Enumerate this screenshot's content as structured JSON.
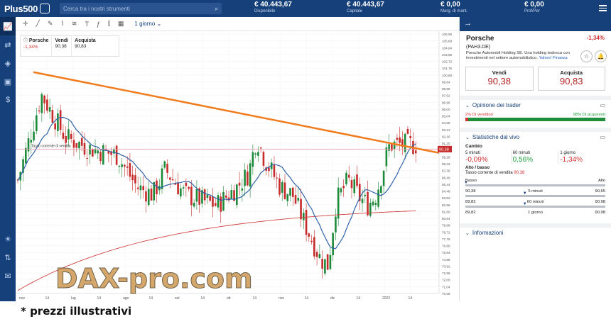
{
  "topbar": {
    "logo": "Plus500",
    "search_placeholder": "Cerca tra i nostri strumenti",
    "stats": [
      {
        "value": "€ 40.443,67",
        "label": "Disponibile"
      },
      {
        "value": "€ 40.443,67",
        "label": "Capitale"
      },
      {
        "value": "€ 0,00",
        "label": "Marg. di mant."
      },
      {
        "value": "€ 0,00",
        "label": "Prof/Per"
      }
    ]
  },
  "toolbar": {
    "timeframe": "1 giorno"
  },
  "infobox": {
    "name": "Porsche",
    "change": "-1,34%",
    "sell_label": "Vendi",
    "sell": "90,38",
    "buy_label": "Acquista",
    "buy": "90,83"
  },
  "chart_data": {
    "type": "candlestick",
    "x_ticks": [
      "nov",
      "14",
      "lug",
      "14",
      "ago",
      "14",
      "set",
      "14",
      "ott",
      "14",
      "nov",
      "14",
      "dic",
      "14",
      "2022",
      "14"
    ],
    "y_ticks": [
      "106,56",
      "105,60",
      "104,64",
      "103,68",
      "102,72",
      "101,76",
      "100,80",
      "99,84",
      "98,88",
      "97,92",
      "96,96",
      "96,00",
      "95,04",
      "94,08",
      "93,12",
      "92,16",
      "91,20",
      "90,24",
      "89,28",
      "88,32",
      "87,36",
      "86,40",
      "85,44",
      "84,48",
      "83,52",
      "82,56",
      "81,60",
      "80,64",
      "79,68",
      "78,72",
      "77,76",
      "76,80",
      "75,84",
      "74,88",
      "73,92",
      "72,96",
      "72,00",
      "71,04",
      "70,08"
    ],
    "ylim": [
      70.08,
      106.56
    ],
    "price_line_label": "90,38",
    "price_line_text": "Tasso corrente di vendita",
    "price": 90.38,
    "trendline": [
      [
        0.04,
        101.2
      ],
      [
        0.975,
        89.6
      ]
    ],
    "colors": {
      "up": "#1d8a3a",
      "down": "#c62a2a",
      "ma_fast": "#2f62a8",
      "ma_slow": "#d24242",
      "trend": "#f07c1e"
    }
  },
  "watermark": "DAX-pro.com",
  "panel": {
    "name": "Porsche",
    "change": "-1,34%",
    "ticker": "(PAH3.DE)",
    "description": "Porsche Automobil Holding SE. Una holding tedesca con investimenti nel settore automobilistico.",
    "source": "Yahoo! Finanza",
    "sell_label": "Vendi",
    "sell": "90,38",
    "buy_label": "Acquista",
    "buy": "90,83",
    "sentiment_title": "Opinione dei trader",
    "sellers": "2% Di venditori",
    "buyers": "98% Di acquirenti",
    "sellers_pct": 2,
    "stats_title": "Statistiche dal vivo",
    "cambio_label": "Cambio",
    "cambio": [
      {
        "label": "5 minuti",
        "value": "-0,09%"
      },
      {
        "label": "60 minuti",
        "value": "0,56%"
      },
      {
        "label": "1 giorno",
        "value": "-1,34%"
      }
    ],
    "highlow_label": "Alto / basso",
    "rate_label": "Tasso corrente di vendita",
    "rate": "90,38",
    "low_label": "Basso",
    "high_label": "Alto",
    "ranges": [
      {
        "period": "",
        "low": "",
        "high": ""
      },
      {
        "period": "5 minuti",
        "low": "90,38",
        "high": "90,65"
      },
      {
        "period": "60 minuti",
        "low": "89,82",
        "high": "90,98"
      },
      {
        "period": "1 giorno",
        "low": "89,82",
        "high": "90,98"
      }
    ],
    "info_title": "Informazioni"
  },
  "caption": "* prezzi illustrativi"
}
